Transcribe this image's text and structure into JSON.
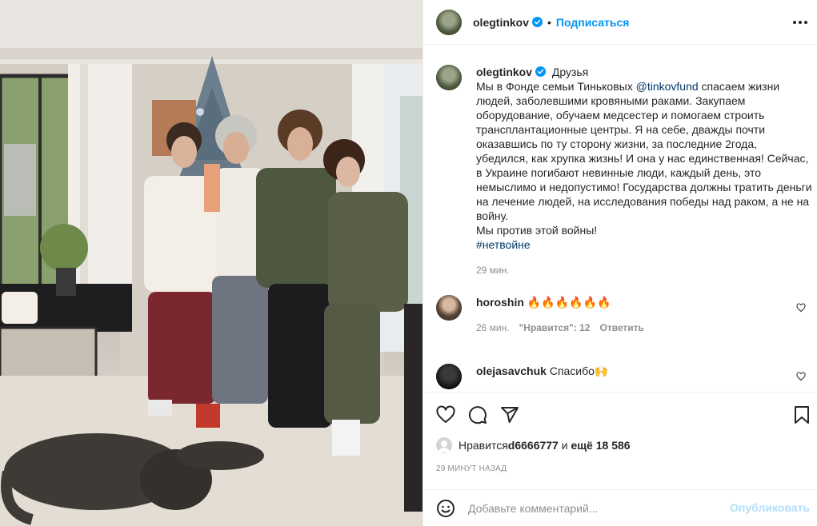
{
  "post": {
    "username": "olegtinkov",
    "follow_label": "Подписаться",
    "dot": "•",
    "more_icon": "more-horizontal-icon"
  },
  "caption": {
    "username": "olegtinkov",
    "audience": "Друзья",
    "line1_pre": "Мы в Фонде семьи Тиньковых ",
    "mention": "@tinkovfund",
    "line1_post": " спасаем жизни людей, заболевшими кровяными раками. Закупаем оборудование, обучаем медсестер и помогаем строить трансплантационные центры. Я на себе, дважды почти оказавшись по ту сторону жизни, за последние 2года, убедился, как хрупка жизнь! И она у нас единственная! Сейчас, в Украине погибают невинные люди, каждый день, это немыслимо и недопустимо! Государства должны тратить деньги на лечение людей, на исследования победы над раком, а не на войну.",
    "line2": "Мы против этой войны!",
    "hashtag": "#нетвойне",
    "time": "29 мин."
  },
  "comments": [
    {
      "username": "horoshin",
      "text": "🔥🔥🔥🔥🔥🔥",
      "time": "26 мин.",
      "likes": "\"Нравится\": 12",
      "reply": "Ответить"
    },
    {
      "username": "olejasavchuk",
      "text": "Спасибо🙌"
    }
  ],
  "likes": {
    "prefix": "Нравится ",
    "user": "d6666777",
    "middle": " и ",
    "others": "ещё 18 586"
  },
  "timestamp": "29 МИНУТ НАЗАД",
  "add_comment": {
    "placeholder": "Добавьте комментарий...",
    "publish": "Опубликовать"
  },
  "colors": {
    "accent": "#0095f6",
    "link": "#00376b",
    "muted": "#8e8e8e",
    "publish_disabled": "#b2dffc"
  }
}
